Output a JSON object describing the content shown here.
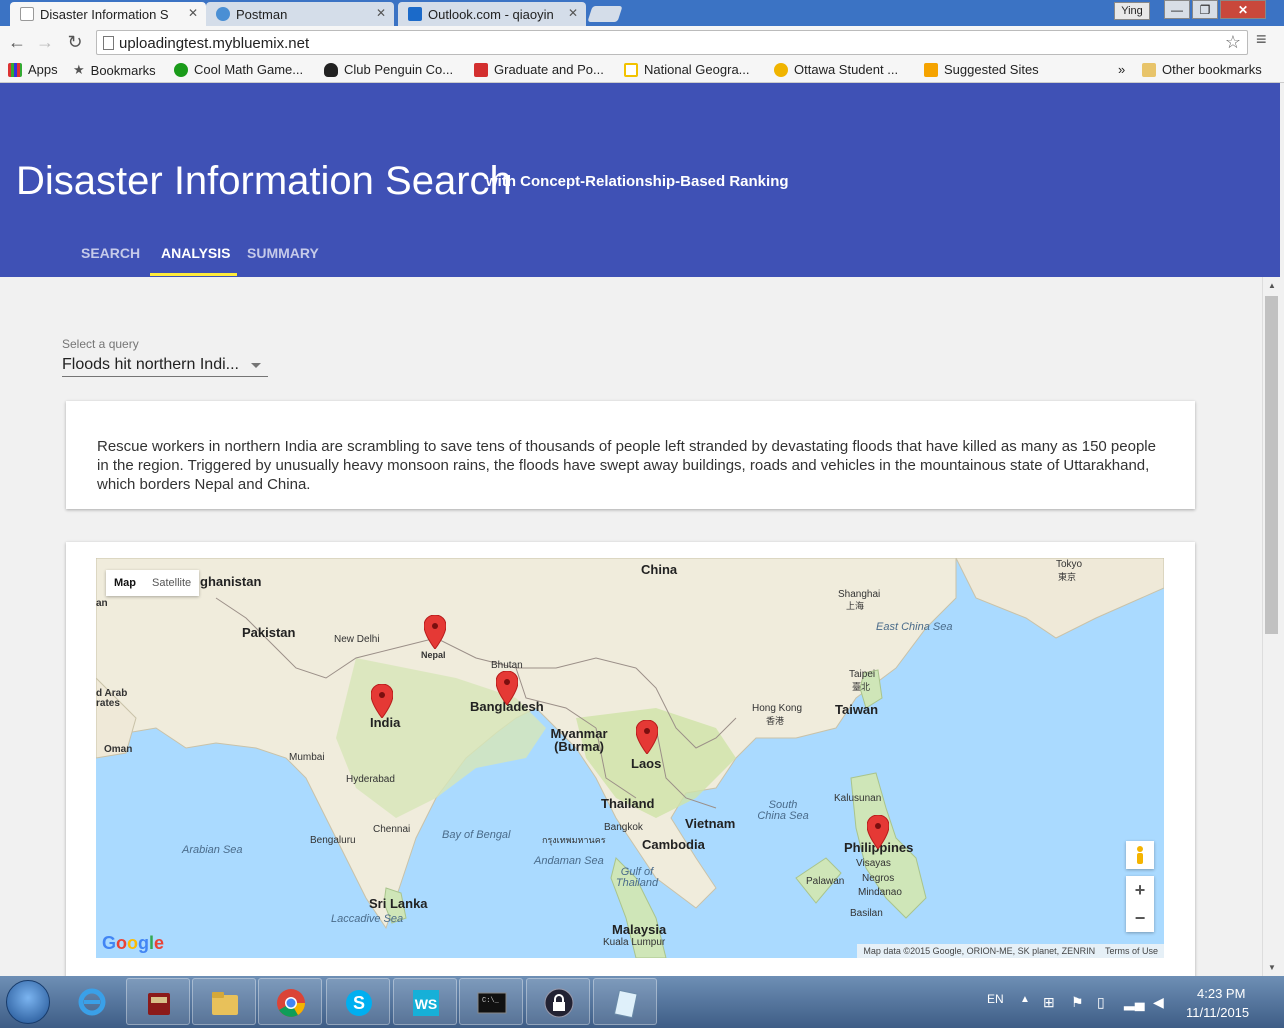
{
  "browser": {
    "tabs": [
      {
        "title": "Disaster Information S",
        "active": true
      },
      {
        "title": "Postman",
        "active": false
      },
      {
        "title": "Outlook.com - qiaoyin",
        "active": false
      }
    ],
    "profile_name": "Ying",
    "url": "uploadingtest.mybluemix.net",
    "bookmarks": [
      "Apps",
      "Bookmarks",
      "Cool Math Game...",
      "Club Penguin Co...",
      "Graduate and Po...",
      "National Geogra...",
      "Ottawa Student ...",
      "Suggested Sites"
    ],
    "bookmarks_overflow": "»",
    "other_bookmarks": "Other bookmarks"
  },
  "header": {
    "title": "Disaster Information Search",
    "subtitle": "with Concept-Relationship-Based Ranking",
    "tabs": [
      {
        "label": "SEARCH",
        "selected": false
      },
      {
        "label": "ANALYSIS",
        "selected": true
      },
      {
        "label": "SUMMARY",
        "selected": false
      }
    ]
  },
  "query_select": {
    "label": "Select a query",
    "value": "Floods hit northern Indi..."
  },
  "description": "Rescue workers in northern India are scrambling to save tens of thousands of people left stranded by devastating floods that have killed as many as 150 people in the region. Triggered by unusually heavy monsoon rains, the floods have swept away buildings, roads and vehicles in the mountainous state of Uttarakhand, which borders Nepal and China.",
  "map": {
    "type_buttons": [
      "Map",
      "Satellite"
    ],
    "markers": [
      "Nepal",
      "India",
      "Bangladesh",
      "Laos",
      "Philippines"
    ],
    "labels_big": [
      "ghanistan",
      "Pakistan",
      "China",
      "India",
      "Bangladesh",
      "Myanmar (Burma)",
      "Laos",
      "Thailand",
      "Vietnam",
      "Cambodia",
      "Sri Lanka",
      "Malaysia",
      "Taiwan",
      "Philippines",
      "Nepal",
      "Bhutan"
    ],
    "labels_small": [
      "New Delhi",
      "Mumbai",
      "Hyderabad",
      "Chennai",
      "Bengaluru",
      "Bangkok",
      "Hong Kong",
      "Taipei",
      "Shanghai",
      "Tokyo",
      "Kalusunan",
      "Visayas",
      "Negros",
      "Mindanao",
      "Palawan",
      "Basilan",
      "Kuala Lumpur",
      "Oman",
      "an",
      "d Arab rates"
    ],
    "labels_sea": [
      "Arabian Sea",
      "Bay of Bengal",
      "Andaman Sea",
      "Gulf of Thailand",
      "South China Sea",
      "East China Sea",
      "Laccadive Sea"
    ],
    "labels_local": [
      "上海",
      "東京",
      "臺北",
      "香港",
      "กรุงเทพมหานคร"
    ],
    "attribution": "Map data ©2015 Google, ORION-ME, SK planet, ZENRIN",
    "terms": "Terms of Use",
    "logo": "Google"
  },
  "taskbar": {
    "language": "EN",
    "time": "4:23 PM",
    "date": "11/11/2015"
  },
  "colors": {
    "header": "#3f51b5",
    "tab_indicator": "#ffeb3b",
    "marker": "#e53935"
  }
}
